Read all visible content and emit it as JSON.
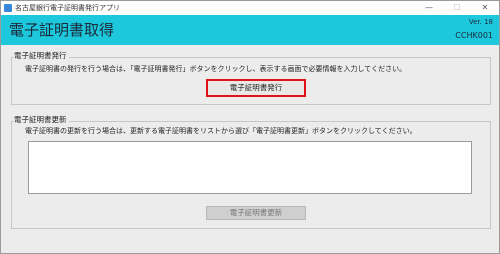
{
  "window": {
    "title": "名古屋銀行電子証明書発行アプリ",
    "minimize_icon": "minimize-icon",
    "maximize_icon": "maximize-icon",
    "close_icon": "close-icon",
    "minimize_glyph": "—",
    "maximize_glyph": "☐",
    "close_glyph": "✕"
  },
  "header": {
    "title": "電子証明書取得",
    "version": "Ver. 18",
    "screen_id": "CCHK001",
    "background_color": "#1ec8dc"
  },
  "issue_section": {
    "label": "電子証明書発行",
    "instruction": "電子証明書の発行を行う場合は、「電子証明書発行」ボタンをクリックし、表示する画面で必要情報を入力してください。",
    "button_label": "電子証明書発行",
    "button_highlight_color": "#e01414"
  },
  "renew_section": {
    "label": "電子証明書更新",
    "instruction": "電子証明書の更新を行う場合は、更新する電子証明書をリストから選び「電子証明書更新」ボタンをクリックしてください。",
    "certificate_list": [],
    "button_label": "電子証明書更新",
    "button_state": "disabled"
  }
}
